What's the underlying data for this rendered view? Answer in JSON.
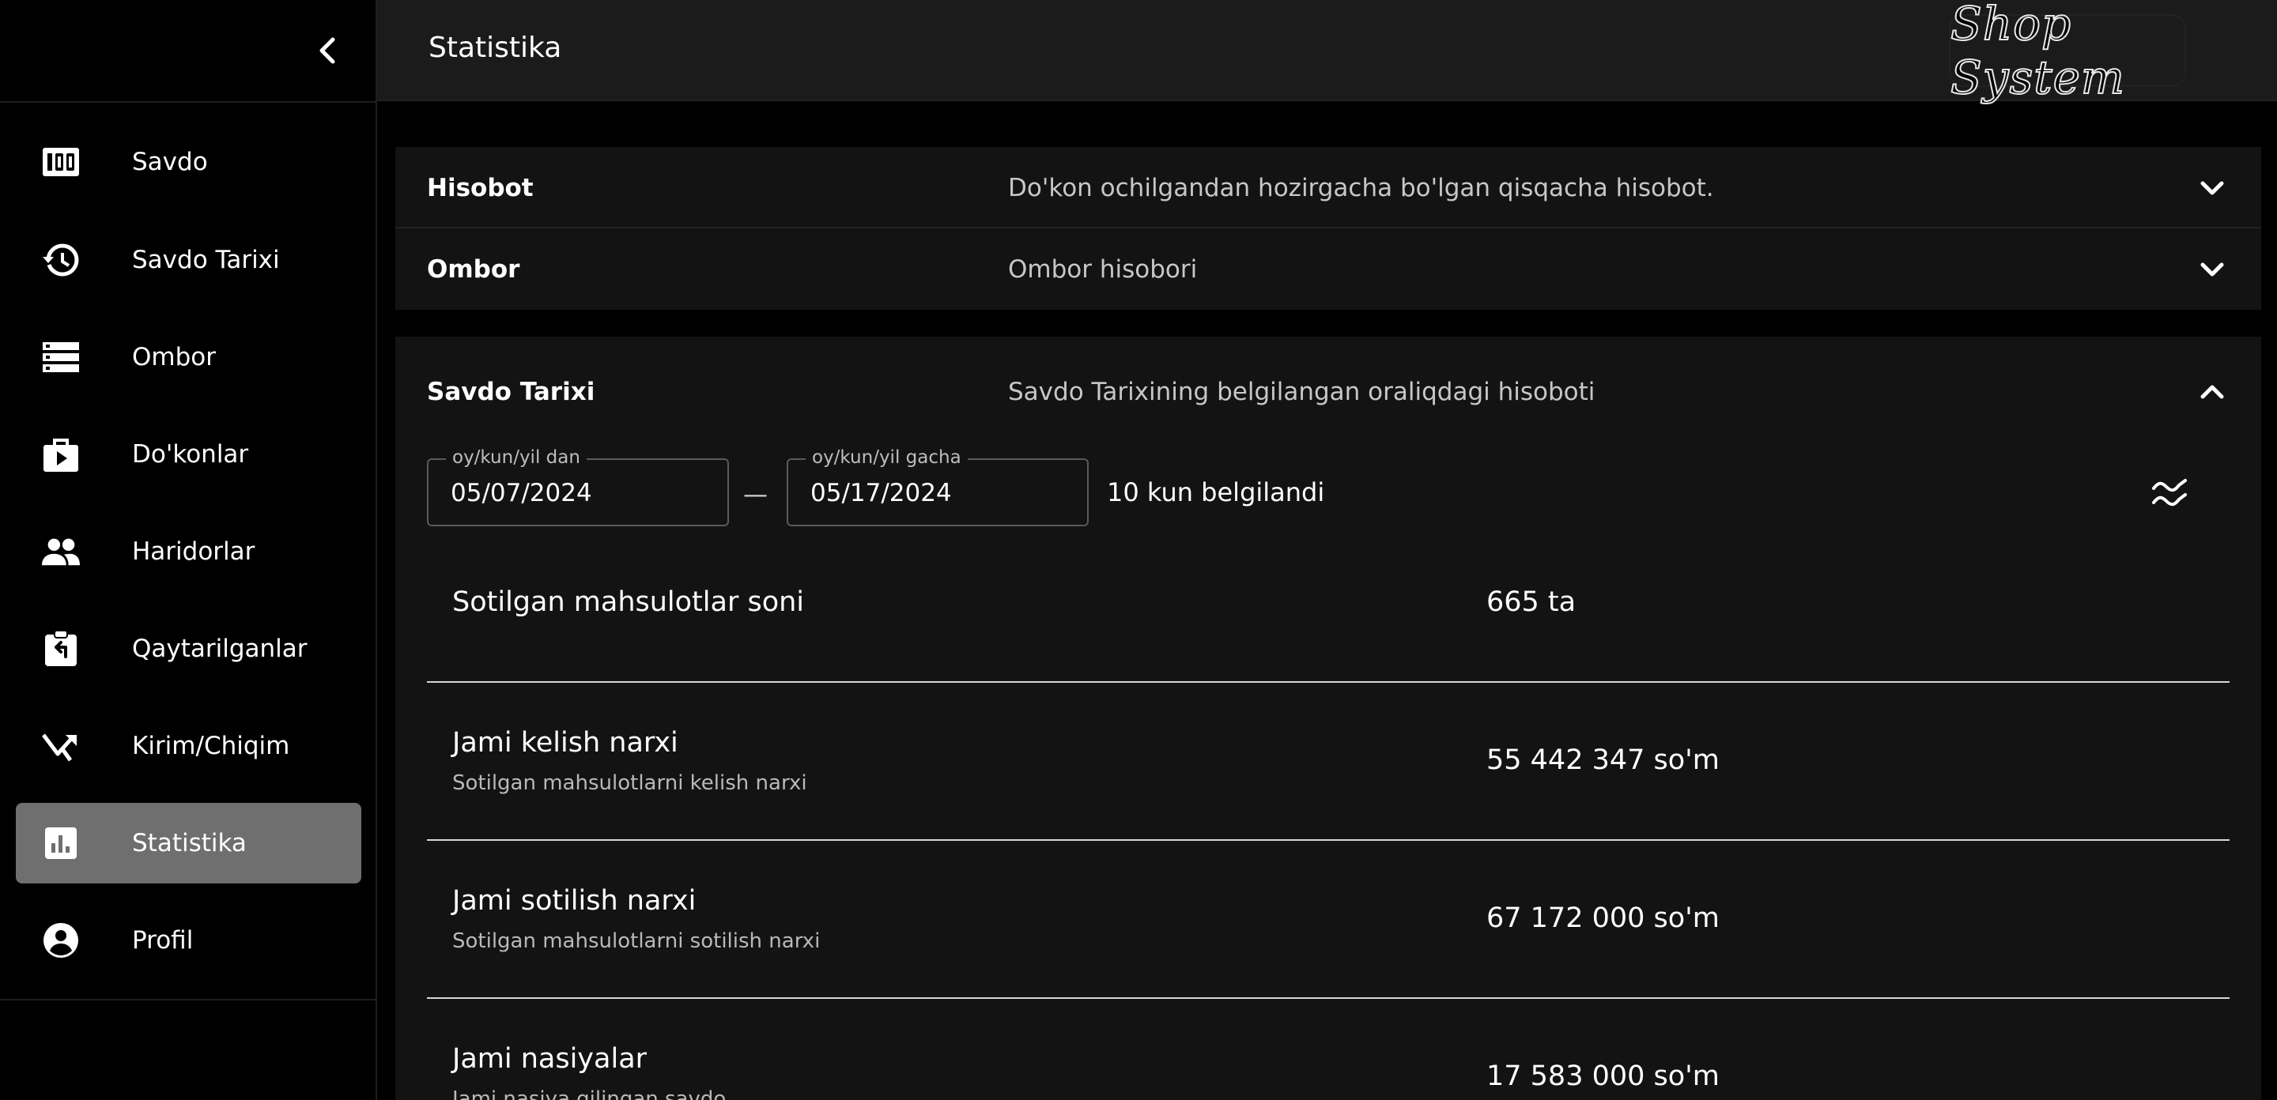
{
  "sidebar": {
    "items": [
      {
        "label": "Savdo",
        "icon": "counter-icon"
      },
      {
        "label": "Savdo Tarixi",
        "icon": "history-icon"
      },
      {
        "label": "Ombor",
        "icon": "storage-icon"
      },
      {
        "label": "Do'konlar",
        "icon": "store-icon"
      },
      {
        "label": "Haridorlar",
        "icon": "people-icon"
      },
      {
        "label": "Qaytarilganlar",
        "icon": "returns-icon"
      },
      {
        "label": "Kirim/Chiqim",
        "icon": "merge-arrow-icon"
      },
      {
        "label": "Statistika",
        "icon": "chart-icon",
        "active": true
      },
      {
        "label": "Profil",
        "icon": "account-circle-icon"
      }
    ]
  },
  "header": {
    "title": "Statistika",
    "brand": "Shop System"
  },
  "accordions": {
    "report": {
      "title": "Hisobot",
      "description": "Do'kon ochilgandan hozirgacha bo'lgan qisqacha hisobot."
    },
    "warehouse": {
      "title": "Ombor",
      "description": "Ombor hisobori"
    },
    "sales_history": {
      "title": "Savdo Tarixi",
      "description": "Savdo Tarixining belgilangan oraliqdagi hisoboti"
    }
  },
  "date_range": {
    "from_label": "oy/kun/yil dan",
    "from_value": "05/07/2024",
    "to_label": "oy/kun/yil gacha",
    "to_value": "05/17/2024",
    "separator": "—",
    "days_text": "10 kun belgilandi"
  },
  "stats": [
    {
      "name": "Sotilgan mahsulotlar soni",
      "sub": "",
      "value": "665 ta"
    },
    {
      "name": "Jami kelish narxi",
      "sub": "Sotilgan mahsulotlarni kelish narxi",
      "value": "55 442 347 so'm"
    },
    {
      "name": "Jami sotilish narxi",
      "sub": "Sotilgan mahsulotlarni sotilish narxi",
      "value": "67 172 000 so'm"
    },
    {
      "name": "Jami nasiyalar",
      "sub": "Jami nasiya qilingan savdo",
      "value": "17 583 000 so'm"
    }
  ],
  "colors": {
    "active_nav": "#6f6f6f",
    "panel": "#131313",
    "header": "#1b1b1b"
  }
}
